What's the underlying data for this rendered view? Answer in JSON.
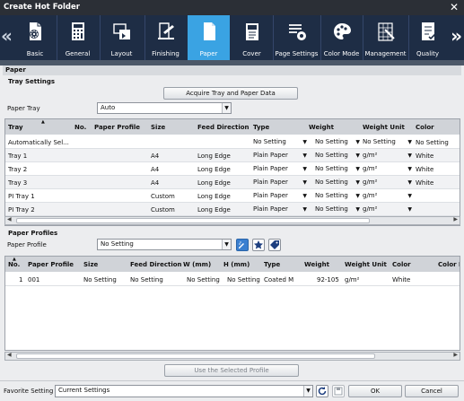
{
  "window": {
    "title": "Create Hot Folder",
    "close": "✕"
  },
  "toolbar": {
    "left_arrow": "«",
    "right_arrow": "»",
    "tabs": [
      {
        "label": "Basic",
        "icon": "folder-gear-icon"
      },
      {
        "label": "General",
        "icon": "calculator-icon"
      },
      {
        "label": "Layout",
        "icon": "layout-icon"
      },
      {
        "label": "Finishing",
        "icon": "finishing-icon"
      },
      {
        "label": "Paper",
        "icon": "paper-icon"
      },
      {
        "label": "Cover",
        "icon": "cover-icon"
      },
      {
        "label": "Page Settings",
        "icon": "page-settings-icon"
      },
      {
        "label": "Color Mode",
        "icon": "palette-icon"
      },
      {
        "label": "Management",
        "icon": "management-icon"
      },
      {
        "label": "Quality",
        "icon": "quality-checklist-icon"
      }
    ],
    "active_tab": "Paper"
  },
  "paper_section": {
    "title": "Paper"
  },
  "tray_settings": {
    "title": "Tray Settings",
    "acquire_button": "Acquire Tray and Paper Data",
    "paper_tray_label": "Paper Tray",
    "paper_tray_value": "Auto",
    "columns": [
      "Tray",
      "No.",
      "Paper Profile",
      "Size",
      "Feed Direction",
      "Type",
      "Weight",
      "Weight Unit",
      "Color"
    ],
    "rows": [
      {
        "tray": "Automatically Sel...",
        "no": "",
        "profile": "",
        "size": "",
        "feed": "",
        "type": "No Setting",
        "weight": "No Setting",
        "unit": "No Setting",
        "color": "No Setting"
      },
      {
        "tray": "Tray 1",
        "no": "",
        "profile": "",
        "size": "A4",
        "feed": "Long Edge",
        "type": "Plain Paper",
        "weight": "No Setting",
        "unit": "g/m²",
        "color": "White"
      },
      {
        "tray": "Tray 2",
        "no": "",
        "profile": "",
        "size": "A4",
        "feed": "Long Edge",
        "type": "Plain Paper",
        "weight": "No Setting",
        "unit": "g/m²",
        "color": "White"
      },
      {
        "tray": "Tray 3",
        "no": "",
        "profile": "",
        "size": "A4",
        "feed": "Long Edge",
        "type": "Plain Paper",
        "weight": "No Setting",
        "unit": "g/m²",
        "color": "White"
      },
      {
        "tray": "PI Tray 1",
        "no": "",
        "profile": "",
        "size": "Custom",
        "feed": "Long Edge",
        "type": "Plain Paper",
        "weight": "No Setting",
        "unit": "g/m²",
        "color": ""
      },
      {
        "tray": "PI Tray 2",
        "no": "",
        "profile": "",
        "size": "Custom",
        "feed": "Long Edge",
        "type": "Plain Paper",
        "weight": "No Setting",
        "unit": "g/m²",
        "color": ""
      }
    ]
  },
  "paper_profiles": {
    "title": "Paper Profiles",
    "profile_label": "Paper Profile",
    "profile_value": "No Setting",
    "columns": [
      "No.",
      "Paper Profile",
      "Size",
      "Feed Direction",
      "W (mm)",
      "H (mm)",
      "Type",
      "Weight",
      "Weight Unit",
      "Color",
      "Color N"
    ],
    "rows": [
      {
        "no": "1",
        "profile": "001",
        "size": "No Setting",
        "feed": "No Setting",
        "w": "No Setting",
        "h": "No Setting",
        "type": "Coated M",
        "weight": "92-105",
        "unit": "g/m²",
        "color": "White"
      }
    ],
    "use_button": "Use the Selected Profile"
  },
  "footer": {
    "favorite_label": "Favorite Setting",
    "favorite_value": "Current Settings",
    "ok": "OK",
    "cancel": "Cancel"
  },
  "colors": {
    "active_tab": "#3aa3e3",
    "toolbar": "#1e2d45",
    "titlebar": "#2b2f36"
  }
}
